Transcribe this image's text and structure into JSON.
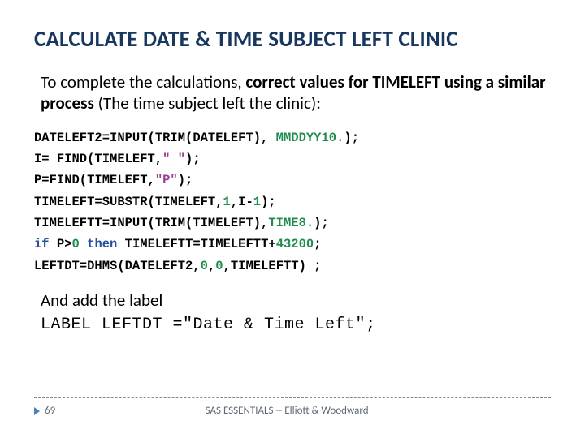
{
  "title": "CALCULATE DATE & TIME SUBJECT LEFT CLINIC",
  "intro": {
    "prefix": "To complete the calculations, ",
    "bold": "correct values for TIMELEFT using a similar process",
    "suffix": " (The time subject left the clinic):"
  },
  "code": {
    "l1a": "DATELEFT2=INPUT(TRIM(DATELEFT),",
    "l1b": "MMDDYY10.",
    "l1c": ");",
    "l2a": "I= FIND(TIMELEFT,",
    "l2b": "\" \"",
    "l2c": ");",
    "l3a": "P=FIND(TIMELEFT,",
    "l3b": "\"P\"",
    "l3c": ");",
    "l4a": "TIMELEFT=SUBSTR(TIMELEFT,",
    "l4b": "1",
    "l4c": ",I-",
    "l4d": "1",
    "l4e": ");",
    "l5a": "TIMELEFTT=INPUT(TRIM(TIMELEFT),",
    "l5b": "TIME8.",
    "l5c": ");",
    "l6a": "if",
    "l6b": " P>",
    "l6c": "0",
    "l6d": " ",
    "l6e": "then",
    "l6f": " TIMELEFTT=TIMELEFTT+",
    "l6g": "43200",
    "l6h": ";",
    "l7a": "LEFTDT=DHMS(DATELEFT2,",
    "l7b": "0",
    "l7c": ",",
    "l7d": "0",
    "l7e": ",TIMELEFTT) ;"
  },
  "post": "And add the label",
  "label_code": "LABEL LEFTDT =\"Date & Time Left\";",
  "footer": {
    "page": "69",
    "text": "SAS ESSENTIALS -- Elliott & Woodward"
  }
}
